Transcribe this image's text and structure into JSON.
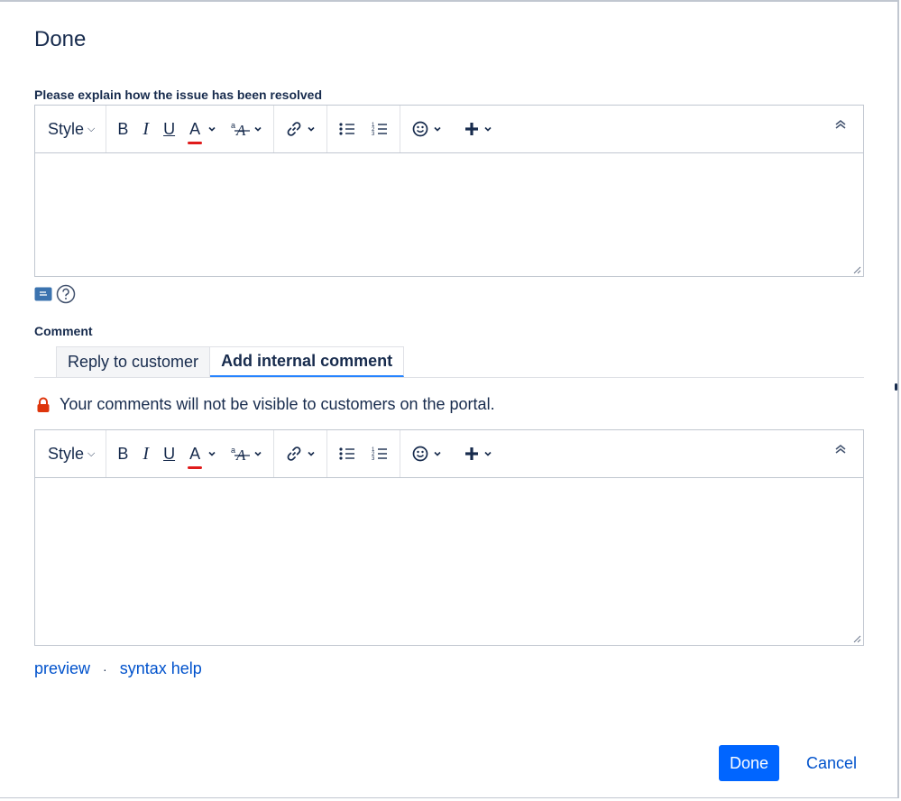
{
  "dialog": {
    "title": "Done"
  },
  "resolution": {
    "label": "Please explain how the issue has been resolved",
    "value": ""
  },
  "toolbar": {
    "style_label": "Style",
    "bold_label": "B",
    "italic_label": "I",
    "underline_label": "U",
    "color_label": "A",
    "more_format_label": "ᵃA",
    "icons": [
      "link-icon",
      "bullet-list-icon",
      "numbered-list-icon",
      "emoji-icon",
      "plus-icon",
      "collapse-icon"
    ]
  },
  "comment": {
    "label": "Comment",
    "tabs": [
      {
        "label": "Reply to customer",
        "active": false
      },
      {
        "label": "Add internal comment",
        "active": true
      }
    ],
    "notice": "Your comments will not be visible to customers on the portal.",
    "value": ""
  },
  "links": {
    "preview": "preview",
    "separator": "·",
    "syntax_help": "syntax help"
  },
  "actions": {
    "done": "Done",
    "cancel": "Cancel"
  },
  "colors": {
    "primary": "#0065ff",
    "link": "#0052cc",
    "text": "#172b4d",
    "lock": "#de350b",
    "color_underline": "#e01b1b"
  }
}
